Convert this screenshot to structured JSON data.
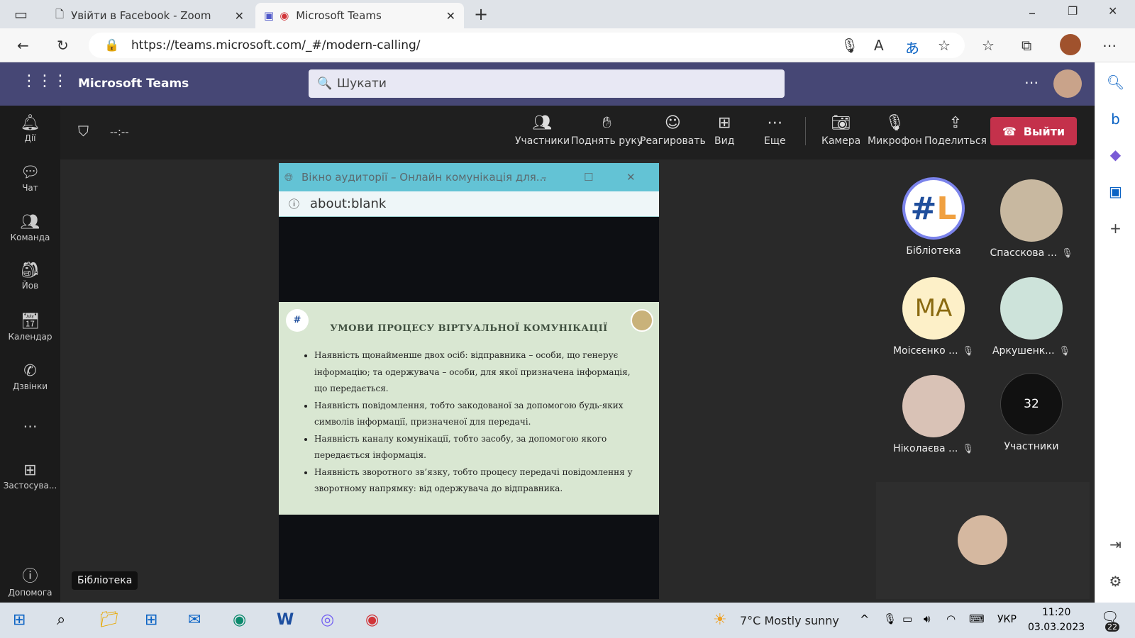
{
  "browser": {
    "tabs": [
      {
        "label": "Увійти в Facebook - Zoom",
        "active": false
      },
      {
        "label": "Microsoft Teams",
        "active": true
      }
    ],
    "url": "https://teams.microsoft.com/_#/modern-calling/"
  },
  "teams": {
    "app_title": "Microsoft Teams",
    "search_placeholder": "Шукати",
    "accent": "#464775",
    "rail": [
      {
        "label": "Дії",
        "icon": "bell-icon"
      },
      {
        "label": "Чат",
        "icon": "chat-icon"
      },
      {
        "label": "Команда",
        "icon": "team-icon"
      },
      {
        "label": "Йов",
        "icon": "backpack-icon"
      },
      {
        "label": "Календар",
        "icon": "calendar-icon"
      },
      {
        "label": "Дзвінки",
        "icon": "phone-icon"
      },
      {
        "label": "Застосува...",
        "icon": "apps-icon"
      },
      {
        "label": "Допомога",
        "icon": "help-icon"
      }
    ],
    "timer": "--:--",
    "toolbar": [
      {
        "label": "Участники"
      },
      {
        "label": "Поднять руку"
      },
      {
        "label": "Реагировать"
      },
      {
        "label": "Вид"
      },
      {
        "label": "Еще"
      },
      {
        "label": "Камера"
      },
      {
        "label": "Микрофон"
      },
      {
        "label": "Поделиться"
      }
    ],
    "leave_label": "Выйти",
    "tooltip": "Бібліотека"
  },
  "shared_window": {
    "title": "Вікно аудиторії – Онлайн комунікація для...",
    "url": "about:blank",
    "slide": {
      "title": "УМОВИ ПРОЦЕСУ ВІРТУАЛЬНОЇ КОМУНІКАЦІЇ",
      "bullets": [
        "Наявність щонайменше двох осіб: відправника – особи, що генерує інформацію; та одержувача – особи, для якої призначена інформація, що передається.",
        "Наявність повідомлення, тобто закодованої за допомогою будь-яких символів інформації, призначеної для передачі.",
        "Наявність каналу комунікації, тобто засобу, за допомогою якого передається інформація.",
        "Наявність зворотного зв’язку, тобто процесу передачі повідомлення у зворотному напрямку: від одержувача до відправника."
      ]
    }
  },
  "gallery": [
    {
      "name": "Бібліотека",
      "muted": false,
      "logo_text": "#L"
    },
    {
      "name": "Спасскова ...",
      "muted": true
    },
    {
      "name": "Моісєєнко ...",
      "muted": true,
      "initials": "MA"
    },
    {
      "name": "Аркушенк...",
      "muted": true
    },
    {
      "name": "Ніколаєва ...",
      "muted": true
    },
    {
      "name": "Участники",
      "count": "32"
    }
  ],
  "taskbar": {
    "weather": "7°C  Mostly sunny",
    "lang": "УКР",
    "time": "11:20",
    "date": "03.03.2023",
    "notifications": "22"
  }
}
